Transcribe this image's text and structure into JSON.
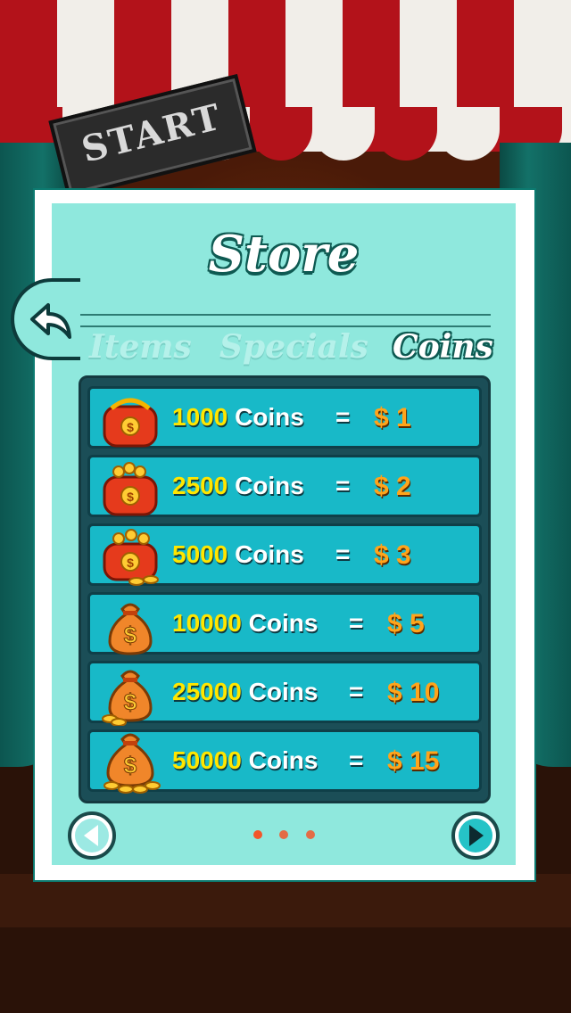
{
  "background": {
    "start_sign": "START"
  },
  "store": {
    "title": "Store",
    "tabs": [
      {
        "label": "Items",
        "active": false
      },
      {
        "label": "Specials",
        "active": false
      },
      {
        "label": "Coins",
        "active": true
      }
    ],
    "items": [
      {
        "amount": "1000",
        "unit": "Coins",
        "eq": "=",
        "price": "$ 1",
        "icon": "coin-purse-icon"
      },
      {
        "amount": "2500",
        "unit": "Coins",
        "eq": "=",
        "price": "$ 2",
        "icon": "coin-purse-icon"
      },
      {
        "amount": "5000",
        "unit": "Coins",
        "eq": "=",
        "price": "$ 3",
        "icon": "coin-purse-icon"
      },
      {
        "amount": "10000",
        "unit": "Coins",
        "eq": "=",
        "price": "$ 5",
        "icon": "money-bag-icon"
      },
      {
        "amount": "25000",
        "unit": "Coins",
        "eq": "=",
        "price": "$ 10",
        "icon": "money-bag-icon"
      },
      {
        "amount": "50000",
        "unit": "Coins",
        "eq": "=",
        "price": "$ 15",
        "icon": "money-bag-icon"
      }
    ],
    "pagination": {
      "pages": 3
    },
    "colors": {
      "panel": "#8fe8dd",
      "row": "#18b9c8",
      "amount": "#ffe600",
      "price": "#ffa41b",
      "dot": "#f2562a"
    }
  }
}
